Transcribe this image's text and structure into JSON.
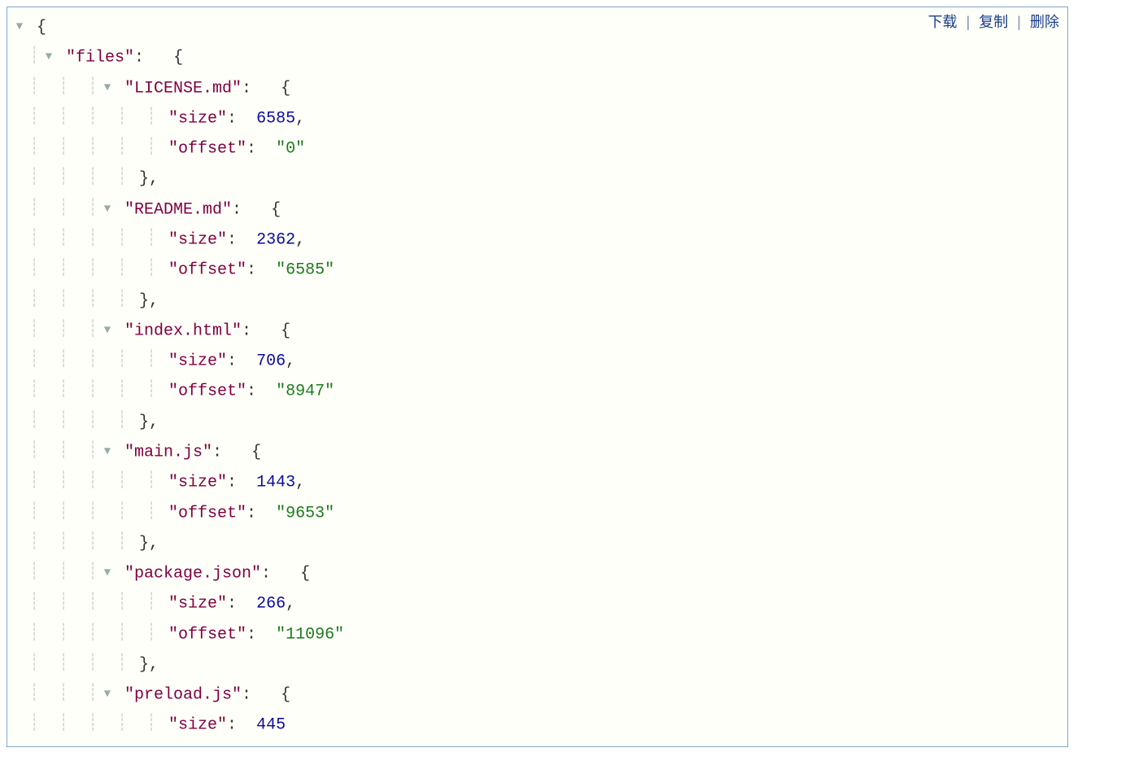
{
  "toolbar": {
    "download": "下载",
    "copy": "复制",
    "delete": "删除"
  },
  "labels": {
    "files": "files",
    "size": "size",
    "offset": "offset"
  },
  "entries": [
    {
      "name": "LICENSE.md",
      "size": 6585,
      "offset": "0"
    },
    {
      "name": "README.md",
      "size": 2362,
      "offset": "6585"
    },
    {
      "name": "index.html",
      "size": 706,
      "offset": "8947"
    },
    {
      "name": "main.js",
      "size": 1443,
      "offset": "9653"
    },
    {
      "name": "package.json",
      "size": 266,
      "offset": "11096"
    },
    {
      "name": "preload.js",
      "size": 445
    }
  ]
}
